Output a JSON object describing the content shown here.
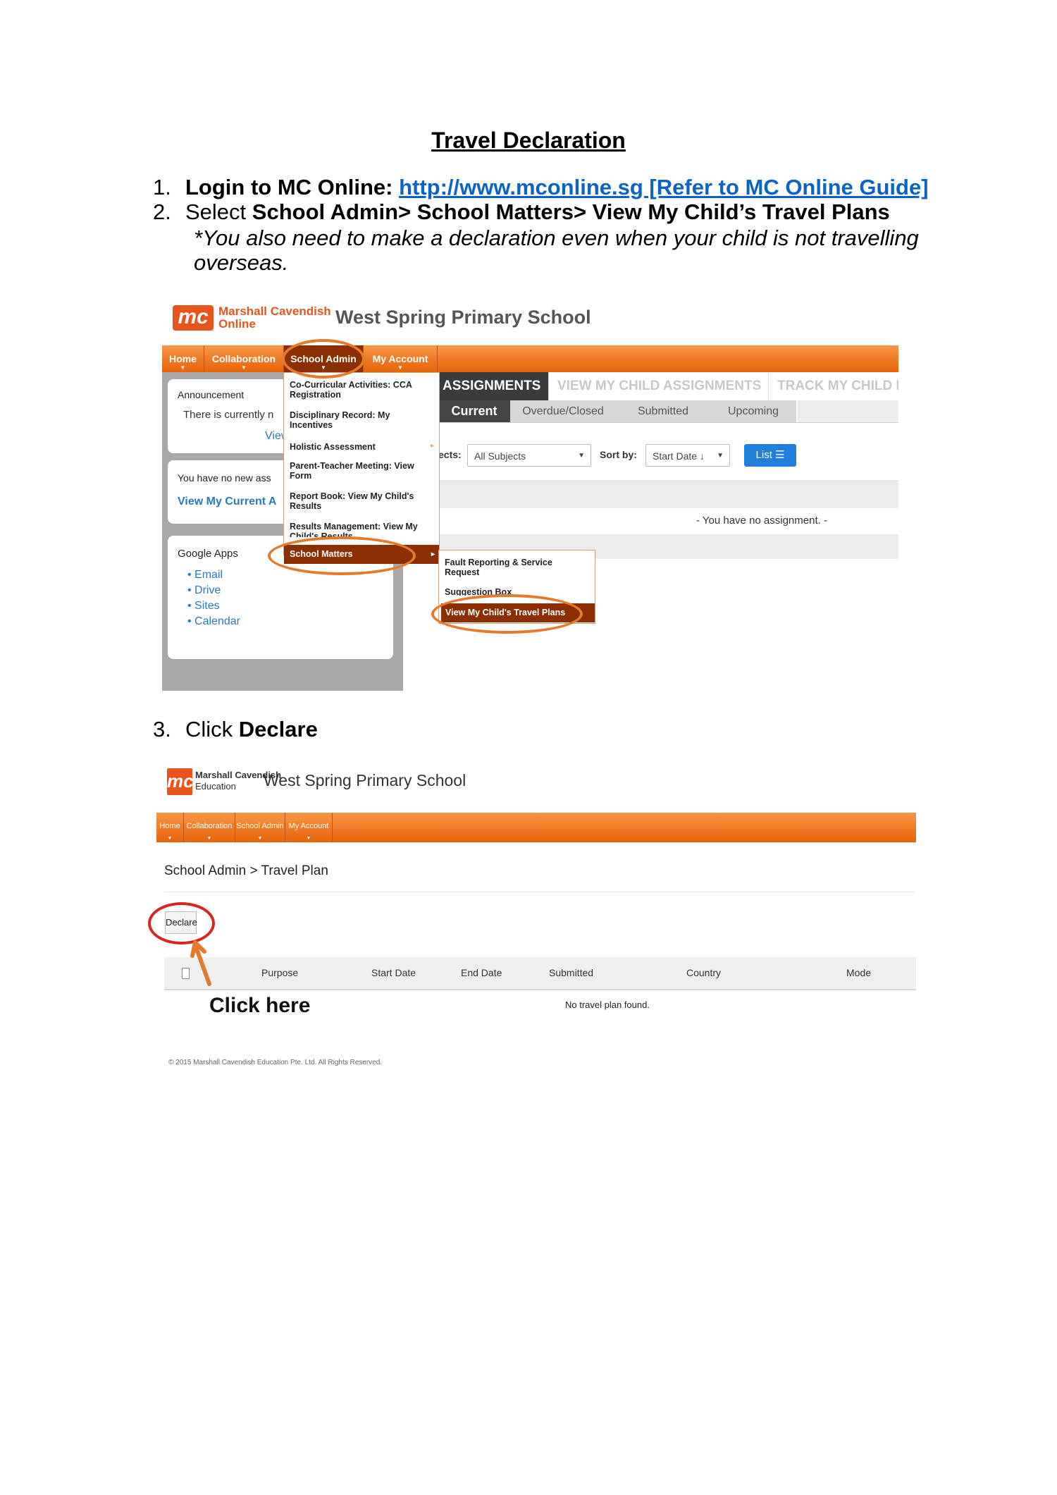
{
  "document": {
    "title": "Travel Declaration",
    "step1": {
      "num": "1.",
      "label": "Login to MC Online:",
      "link": "http://www.mconline.sg [Refer to MC Online Guide]"
    },
    "step2": {
      "num": "2.",
      "prefix": "Select ",
      "path": "School Admin> School Matters> View My Child’s Travel Plans",
      "note": "*You also need to make a declaration even when your child is not travelling overseas."
    },
    "step3": {
      "num": "3.",
      "prefix": "Click ",
      "action": "Declare"
    }
  },
  "screenshot1": {
    "logo_mark": "mc",
    "logo_line1": "Marshall Cavendish",
    "logo_line2": "Online",
    "school_name": "West Spring Primary School",
    "nav": [
      "Home",
      "Collaboration",
      "School Admin",
      "My Account"
    ],
    "announcement": {
      "heading": "Announcement",
      "text": "There is currently n",
      "link": "View"
    },
    "assignments_card": {
      "text": "You have no new ass",
      "link": "View My Current A"
    },
    "google_apps": {
      "heading": "Google Apps",
      "items": [
        "Email",
        "Drive",
        "Sites",
        "Calendar"
      ]
    },
    "tabs": [
      "ASSIGNMENTS",
      "VIEW MY CHILD ASSIGNMENTS",
      "TRACK MY CHILD LE"
    ],
    "subtabs": [
      "Current",
      "Overdue/Closed",
      "Submitted",
      "Upcoming"
    ],
    "filter": {
      "subjects_label": "ects:",
      "subjects_value": "All Subjects",
      "sort_label": "Sort by:",
      "sort_value": "Start Date ↓",
      "list_button": "List ☰"
    },
    "empty_message": "- You have no assignment. -",
    "menu": [
      "Co-Curricular Activities: CCA Registration",
      "Disciplinary Record: My Incentives",
      "Holistic Assessment",
      "Parent-Teacher Meeting: View Form",
      "Report Book: View My Child's Results",
      "Results Management: View My Child's Results",
      "School Matters"
    ],
    "submenu": [
      "Fault Reporting & Service Request",
      "Suggestion Box",
      "View My Child's Travel Plans"
    ]
  },
  "screenshot2": {
    "logo_mark": "mc",
    "logo_line1": "Marshall Cavendish",
    "logo_line2": "Education",
    "school_name": "West Spring Primary School",
    "nav": [
      "Home",
      "Collaboration",
      "School Admin",
      "My Account"
    ],
    "breadcrumb": "School Admin > Travel Plan",
    "declare_button": "Declare",
    "columns": [
      "Purpose",
      "Start Date",
      "End Date",
      "Submitted",
      "Country",
      "Mode"
    ],
    "empty_message": "No travel plan found.",
    "callout": "Click here",
    "footer": "© 2015 Marshall Cavendish Education Pte. Ltd. All Rights Reserved."
  },
  "colors": {
    "orange": "#e8630a",
    "highlight": "#8b2f00",
    "ring_orange": "#e47a2b",
    "ring_red": "#d8261e",
    "link_blue": "#0b63c4"
  }
}
